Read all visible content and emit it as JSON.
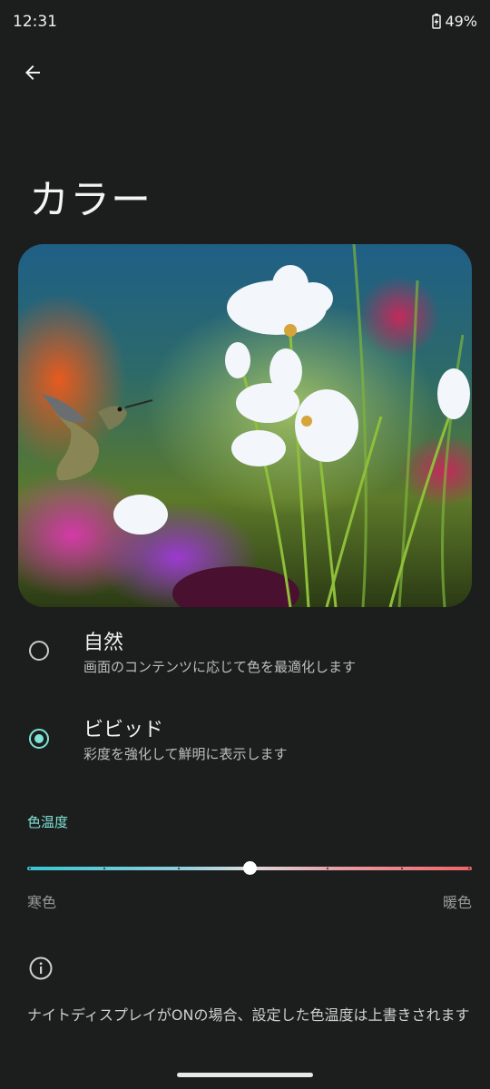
{
  "status": {
    "time": "12:31",
    "battery": "49%"
  },
  "header": {
    "title": "カラー"
  },
  "preview": {
    "description": "hummingbird-cosmos-flowers"
  },
  "options": [
    {
      "title": "自然",
      "subtitle": "画面のコンテンツに応じて色を最適化します",
      "selected": false
    },
    {
      "title": "ビビッド",
      "subtitle": "彩度を強化して鮮明に表示します",
      "selected": true
    }
  ],
  "color_temp": {
    "label": "色温度",
    "min_label": "寒色",
    "max_label": "暖色",
    "value": 0.5
  },
  "info": {
    "icon": "info-icon",
    "text": "ナイトディスプレイがONの場合、設定した色温度は上書きされます"
  },
  "colors": {
    "accent": "#7fe3d6",
    "background": "#1c1d1d"
  }
}
